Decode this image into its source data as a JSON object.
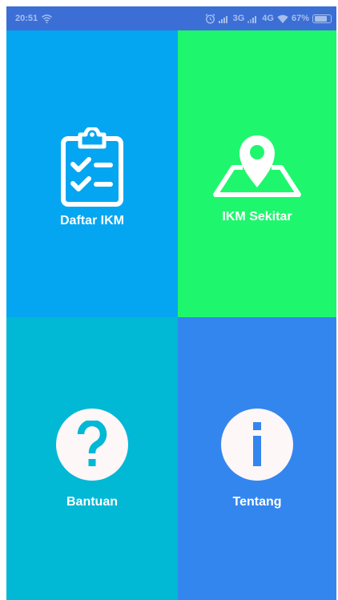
{
  "status_bar": {
    "time": "20:51",
    "network_1": "3G",
    "network_2": "4G",
    "battery_percent": "67%"
  },
  "menu": {
    "tiles": [
      {
        "label": "Daftar IKM",
        "color": "#05a6f1",
        "icon": "clipboard-checklist-icon"
      },
      {
        "label": "IKM Sekitar",
        "color": "#1ef76d",
        "icon": "map-pin-icon"
      },
      {
        "label": "Bantuan",
        "color": "#01b8d5",
        "icon": "question-mark-icon"
      },
      {
        "label": "Tentang",
        "color": "#3486ef",
        "icon": "info-icon"
      }
    ]
  },
  "colors": {
    "status_bar": "#3b6fd6",
    "icon_fill": "#fdf7f7"
  }
}
